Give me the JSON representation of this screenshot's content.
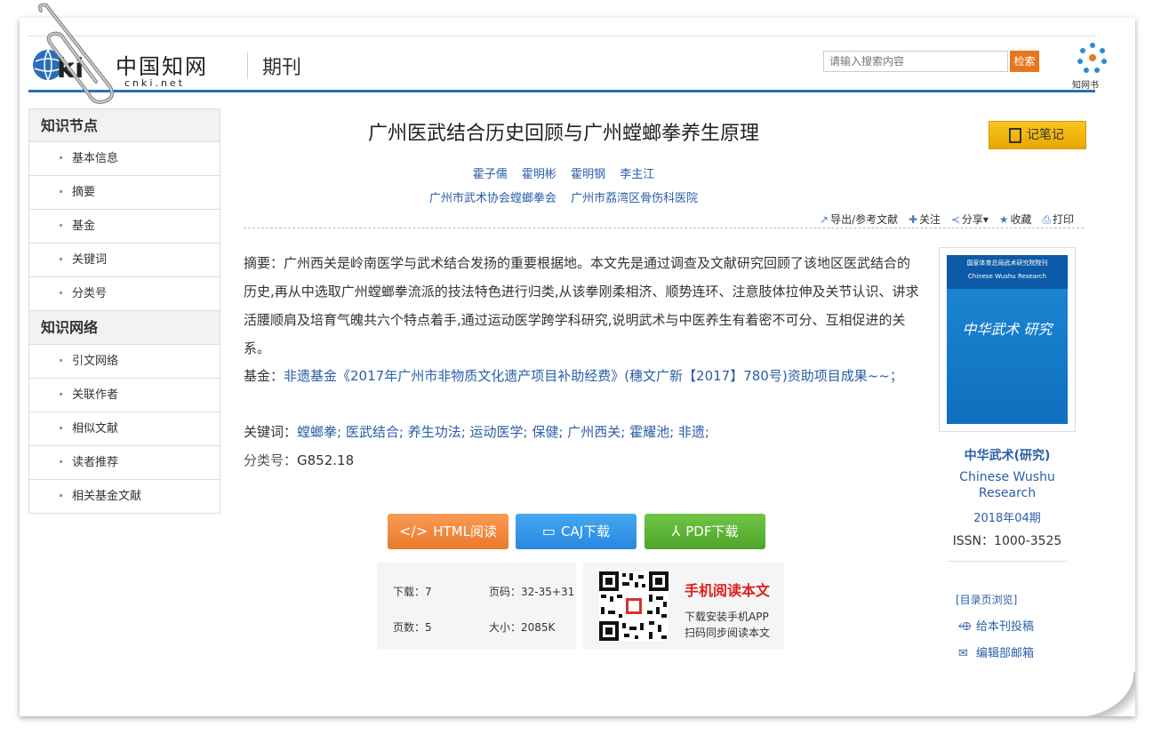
{
  "header": {
    "logo_cn": "中国知网",
    "logo_en": "cnki.net",
    "section": "期刊",
    "search_placeholder": "请输入搜索内容",
    "search_button": "检索",
    "brand_text": "知网书"
  },
  "sidebar": {
    "group1_title": "知识节点",
    "group1_items": [
      "基本信息",
      "摘要",
      "基金",
      "关键词",
      "分类号"
    ],
    "group2_title": "知识网络",
    "group2_items": [
      "引文网络",
      "关联作者",
      "相似文献",
      "读者推荐",
      "相关基金文献"
    ]
  },
  "article": {
    "title": "广州医武结合历史回顾与广州螳螂拳养生原理",
    "note_button": "记笔记",
    "authors": [
      "霍子儒",
      "霍明彬",
      "霍明钢",
      "李主江"
    ],
    "orgs": [
      "广州市武术协会螳螂拳会",
      "广州市荔湾区骨伤科医院"
    ],
    "actions": {
      "export": "导出/参考文献",
      "follow": "关注",
      "share": "分享",
      "favorite": "收藏",
      "print": "打印"
    },
    "abstract_label": "摘要：",
    "abstract_text": "广州西关是岭南医学与武术结合发扬的重要根据地。本文先是通过调查及文献研究回顾了该地区医武结合的历史,再从中选取广州螳螂拳流派的技法特色进行归类,从该拳刚柔相济、顺势连环、注意肢体拉伸及关节认识、讲求活腰顺肩及培育气魄共六个特点着手,通过运动医学跨学科研究,说明武术与中医养生有着密不可分、互相促进的关系。",
    "fund_label": "基金：",
    "fund_text": "非遗基金《2017年广州市非物质文化遗产项目补助经费》(穗文广新【2017】780号)资助项目成果~~；",
    "keywords_label": "关键词：",
    "keywords": [
      "螳螂拳;",
      "医武结合;",
      "养生功法;",
      "运动医学;",
      "保健;",
      "广州西关;",
      "霍耀池;",
      "非遗;"
    ],
    "class_label": "分类号：",
    "class_value": "G852.18"
  },
  "downloads": {
    "html": "HTML阅读",
    "caj": "CAJ下载",
    "pdf": "PDF下载"
  },
  "stats": {
    "downloads_label": "下载：",
    "downloads_value": "7",
    "pages_range_label": "页码：",
    "pages_range_value": "32-35+31",
    "page_count_label": "页数：",
    "page_count_value": "5",
    "size_label": "大小：",
    "size_value": "2085K"
  },
  "mobile": {
    "title": "手机阅读本文",
    "line1": "下载安装手机APP",
    "line2": "扫码同步阅读本文"
  },
  "journal": {
    "cover_top": "国家体育总局武术研究院院刊",
    "cover_sub": "Chinese Wushu Research",
    "cover_title": "中华武术 研究",
    "name": "中华武术(研究)",
    "name_en": "Chinese Wushu Research",
    "issue": "2018年04期",
    "issn": "ISSN：1000-3525",
    "toc_link": "[目录页浏览]",
    "submit_link": "给本刊投稿",
    "mail_link": "编辑部邮箱"
  },
  "colors": {
    "link_blue": "#2a5ea8",
    "header_blue": "#2a6ebb",
    "search_orange": "#e8761b",
    "note_yellow": "#f8c520",
    "html_orange": "#e97a2a",
    "caj_blue": "#2887e0",
    "pdf_green": "#4ea62a",
    "mobile_red": "#e02020"
  }
}
